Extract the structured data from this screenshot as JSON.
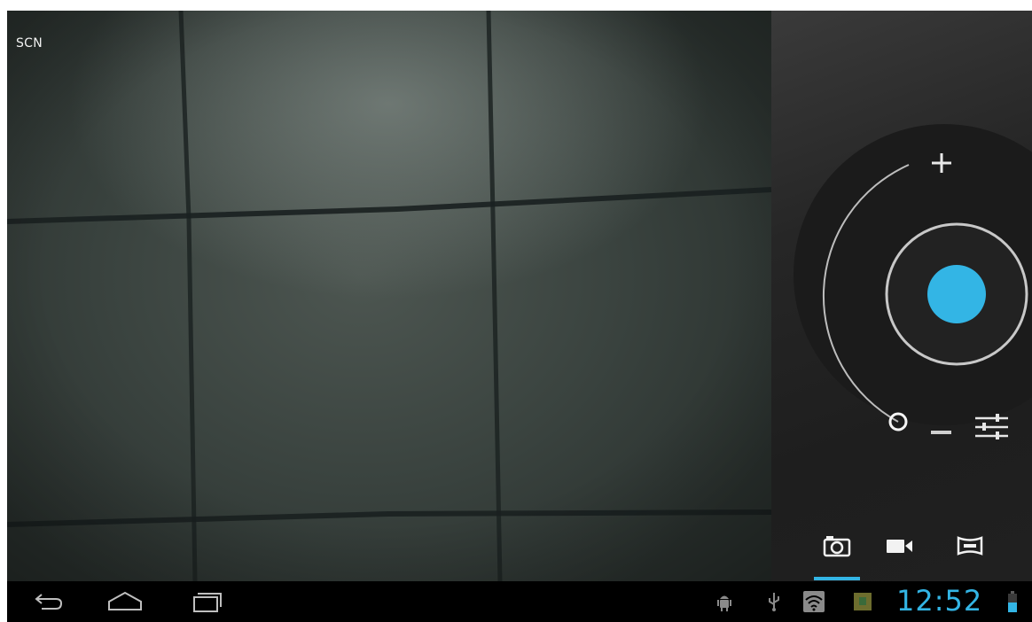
{
  "viewfinder": {
    "scene_mode_label": "SCN"
  },
  "controls": {
    "zoom_in_icon": "plus-icon",
    "zoom_out_icon": "minus-icon",
    "zoom_level": 0,
    "shutter_color": "#33b5e5",
    "settings_icon": "sliders-icon"
  },
  "modes": {
    "items": [
      {
        "name": "camera",
        "icon": "camera-icon",
        "selected": true
      },
      {
        "name": "video",
        "icon": "video-camera-icon",
        "selected": false
      },
      {
        "name": "panorama",
        "icon": "panorama-icon",
        "selected": false
      }
    ],
    "indicator_color": "#33b5e5"
  },
  "system_bar": {
    "nav": [
      {
        "name": "back",
        "icon": "back-icon"
      },
      {
        "name": "home",
        "icon": "home-icon"
      },
      {
        "name": "recent-apps",
        "icon": "recent-apps-icon"
      }
    ],
    "status_icons": [
      "android-debug-icon",
      "usb-icon",
      "wifi-icon",
      "sd-card-icon"
    ],
    "clock": "12:52",
    "clock_color": "#33b5e5",
    "battery_level": 0.5
  }
}
